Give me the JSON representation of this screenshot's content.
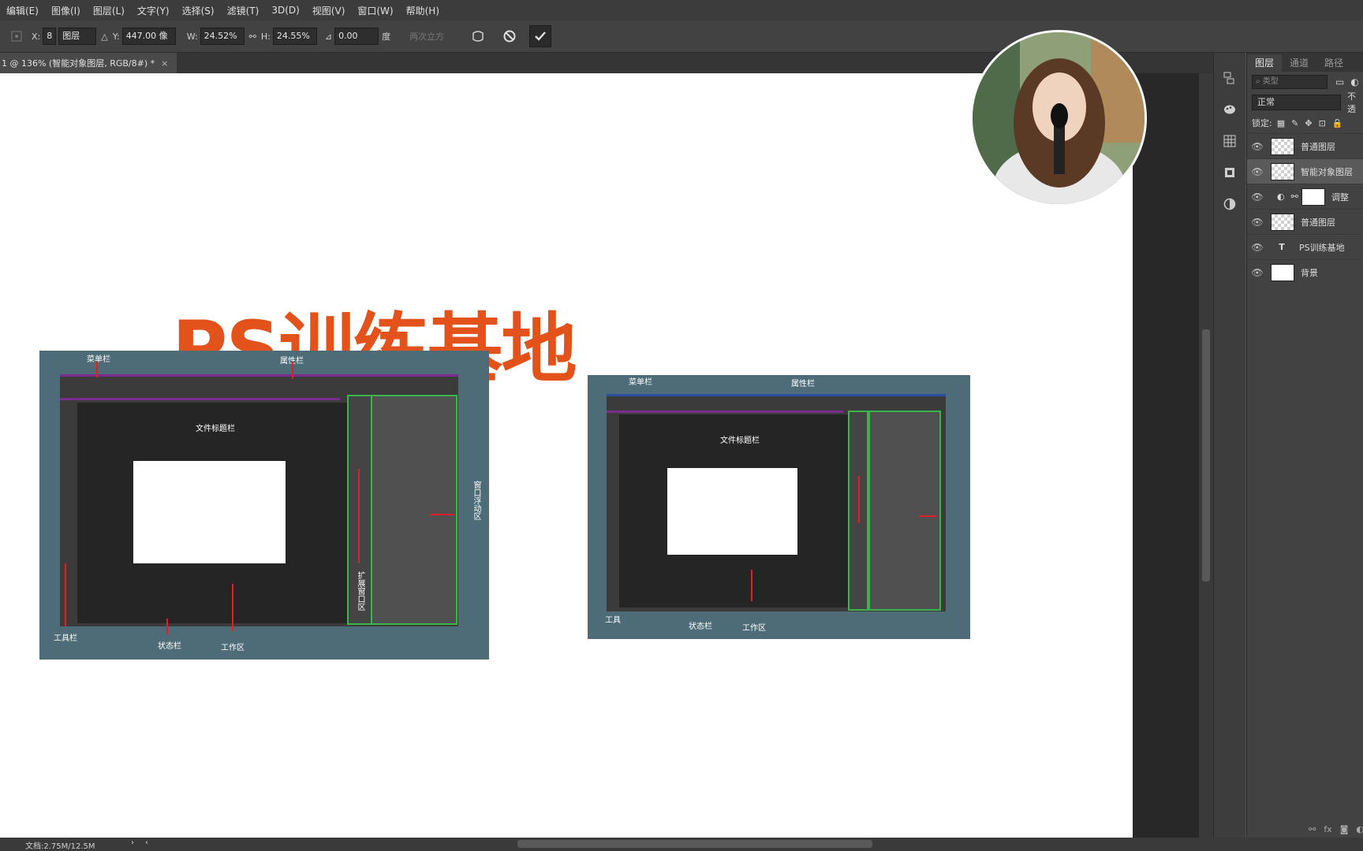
{
  "menubar": {
    "items": [
      "编辑(E)",
      "图像(I)",
      "图层(L)",
      "文字(Y)",
      "选择(S)",
      "滤镜(T)",
      "3D(D)",
      "视图(V)",
      "窗口(W)",
      "帮助(H)"
    ]
  },
  "options": {
    "x_label": "X:",
    "x_value": "8",
    "ref_select": "图层",
    "y_label": "Y:",
    "y_value": "447.00 像",
    "w_label": "W:",
    "w_value": "24.52%",
    "h_label": "H:",
    "h_value": "24.55%",
    "angle_value": "0.00",
    "angle_unit": "度",
    "interp_label": "两次立方"
  },
  "doc_tab": {
    "title": "1 @ 136% (智能对象图层, RGB/8#) *",
    "close": "×"
  },
  "canvas": {
    "headline": "PS训练基地",
    "mock_left": {
      "labels": {
        "menubar": "菜单栏",
        "options": "属性栏",
        "titlebar": "文件标题栏",
        "panels": "窗口浮动区",
        "toolbar": "工具栏",
        "status": "状态栏",
        "work": "工作区",
        "collapsed": "扩展窗口区"
      }
    },
    "mock_right": {
      "labels": {
        "menubar": "菜单栏",
        "options": "属性栏",
        "titlebar": "文件标题栏",
        "toolbar": "工具",
        "status": "状态栏",
        "work": "工作区"
      }
    }
  },
  "status": {
    "doc_info": "文档:2.75M/12.5M"
  },
  "layers_panel": {
    "tabs": [
      "图层",
      "通道",
      "路径"
    ],
    "filter_placeholder": "类型",
    "blend_mode": "正常",
    "opacity_label": "不透",
    "lock_label": "锁定:",
    "layers": [
      {
        "name": "普通图层",
        "type": "checker-img"
      },
      {
        "name": "智能对象图层",
        "type": "smart"
      },
      {
        "name": "调整",
        "type": "adjust"
      },
      {
        "name": "普通图层",
        "type": "checker"
      },
      {
        "name": "PS训练基地",
        "type": "text"
      },
      {
        "name": "背景",
        "type": "white"
      }
    ]
  }
}
